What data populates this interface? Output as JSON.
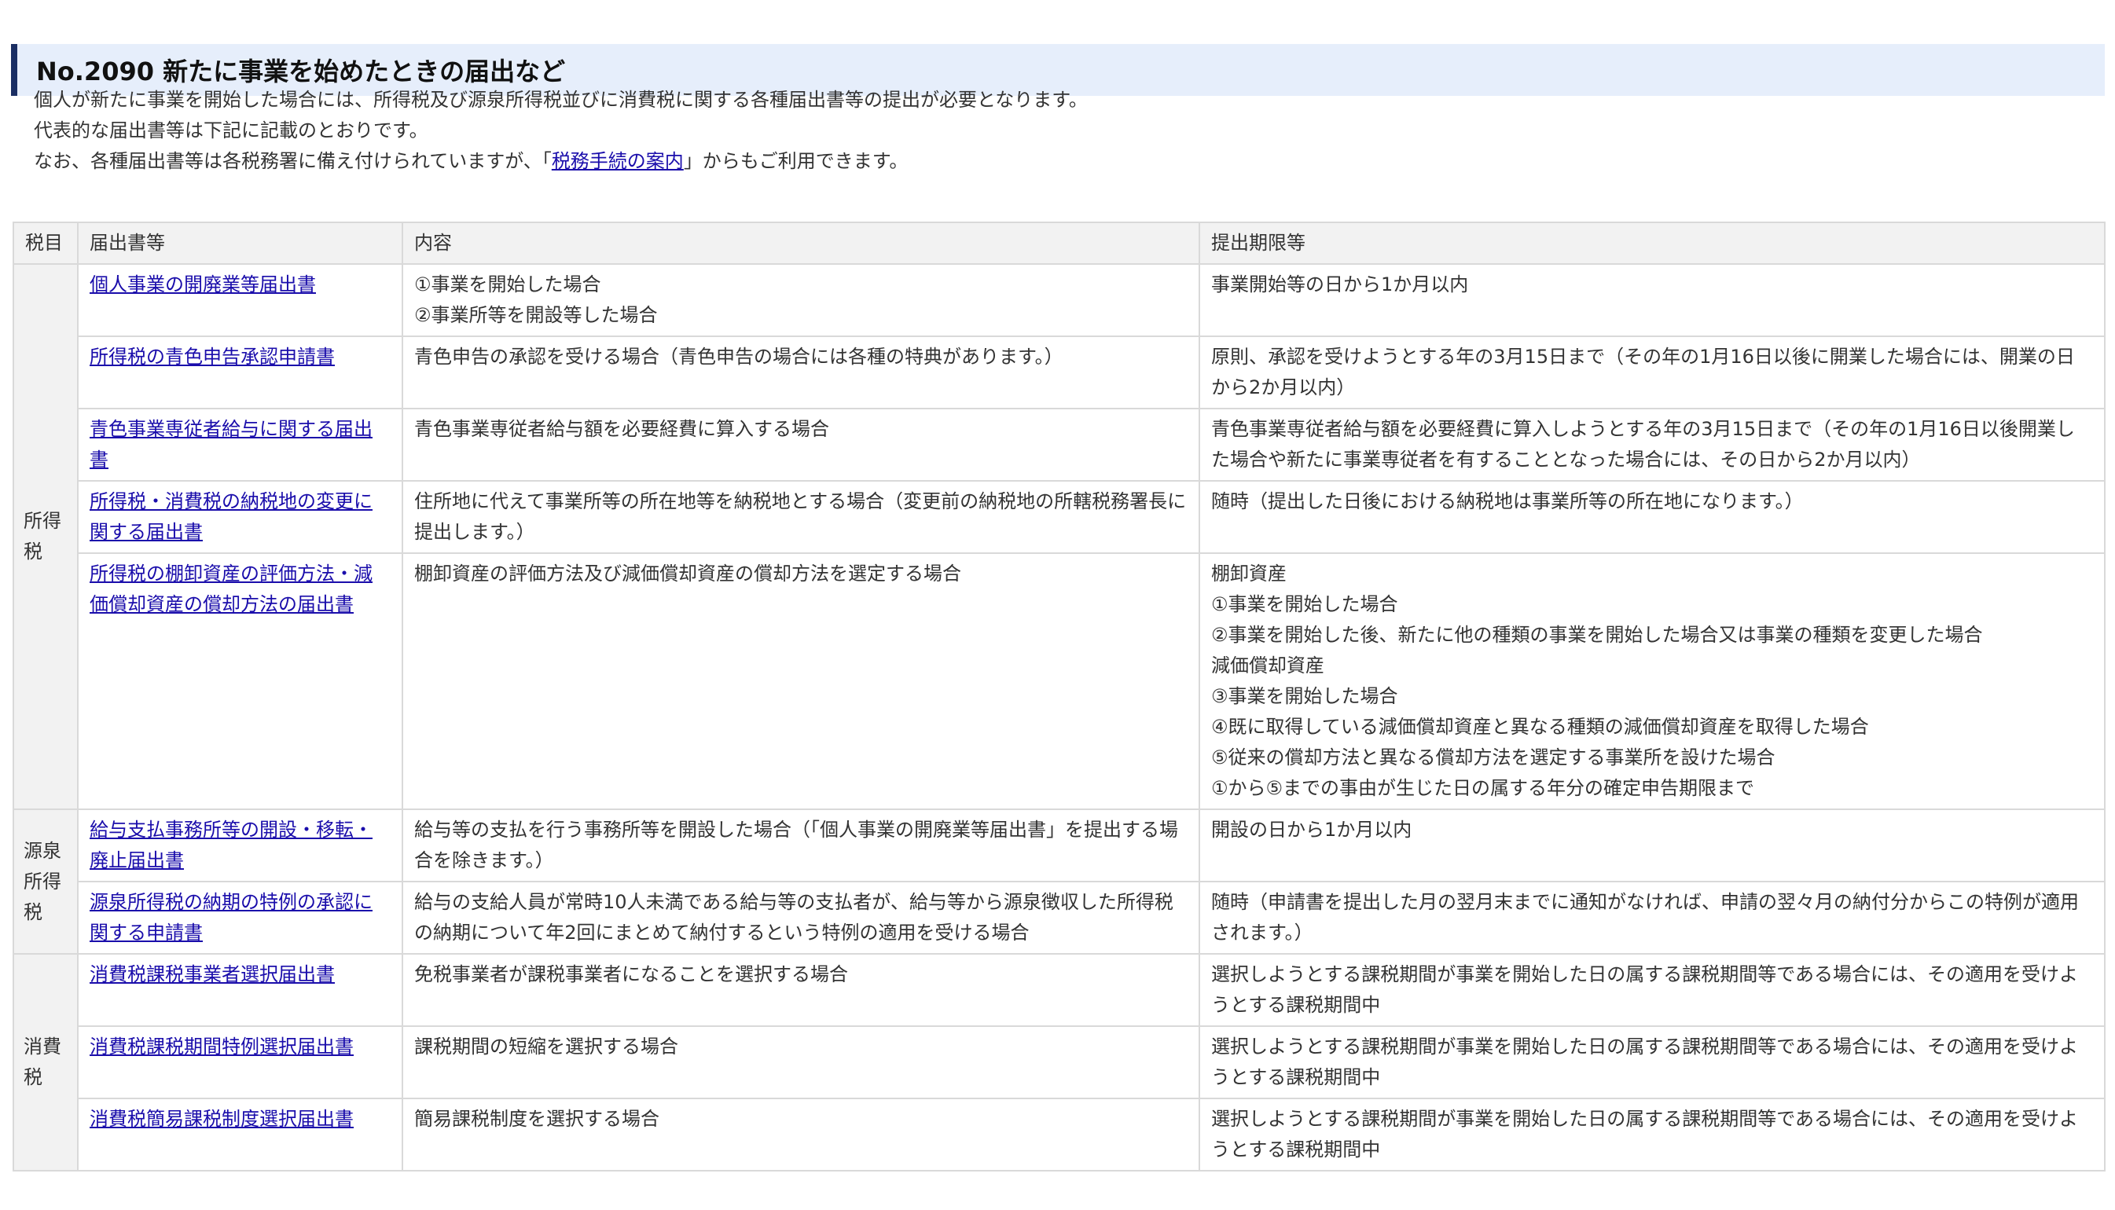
{
  "title": "No.2090 新たに事業を始めたときの届出など",
  "intro": {
    "line1": "個人が新たに事業を開始した場合には、所得税及び源泉所得税並びに消費税に関する各種届出書等の提出が必要となります。",
    "line2": "代表的な届出書等は下記に記載のとおりです。",
    "line3_before": "なお、各種届出書等は各税務署に備え付けられていますが、「",
    "line3_link": "税務手続の案内",
    "line3_after": "」からもご利用できます。"
  },
  "table": {
    "headers": [
      "税目",
      "届出書等",
      "内容",
      "提出期限等"
    ],
    "groups": [
      {
        "tax": "所得税",
        "tax_lines": [
          "所得",
          "税"
        ],
        "rows": [
          {
            "form": "個人事業の開廃業等届出書",
            "content": [
              "①事業を開始した場合",
              "②事業所等を開設等した場合"
            ],
            "deadline": [
              "事業開始等の日から1か月以内"
            ]
          },
          {
            "form": "所得税の青色申告承認申請書",
            "content": [
              "青色申告の承認を受ける場合（青色申告の場合には各種の特典があります。）"
            ],
            "deadline": [
              "原則、承認を受けようとする年の3月15日まで（その年の1月16日以後に開業した場合には、開業の日から2か月以内）"
            ]
          },
          {
            "form": "青色事業専従者給与に関する届出書",
            "content": [
              "青色事業専従者給与額を必要経費に算入する場合"
            ],
            "deadline": [
              "青色事業専従者給与額を必要経費に算入しようとする年の3月15日まで（その年の1月16日以後開業した場合や新たに事業専従者を有することとなった場合には、その日から2か月以内）"
            ]
          },
          {
            "form": "所得税・消費税の納税地の変更に関する届出書",
            "content": [
              "住所地に代えて事業所等の所在地等を納税地とする場合（変更前の納税地の所轄税務署長に提出します。）"
            ],
            "deadline": [
              "随時（提出した日後における納税地は事業所等の所在地になります。）"
            ]
          },
          {
            "form": "所得税の棚卸資産の評価方法・減価償却資産の償却方法の届出書",
            "content": [
              "棚卸資産の評価方法及び減価償却資産の償却方法を選定する場合"
            ],
            "deadline": [
              "棚卸資産",
              "①事業を開始した場合",
              "②事業を開始した後、新たに他の種類の事業を開始した場合又は事業の種類を変更した場合",
              "減価償却資産",
              "③事業を開始した場合",
              "④既に取得している減価償却資産と異なる種類の減価償却資産を取得した場合",
              "⑤従来の償却方法と異なる償却方法を選定する事業所を設けた場合",
              "①から⑤までの事由が生じた日の属する年分の確定申告期限まで"
            ]
          }
        ]
      },
      {
        "tax": "源泉所得税",
        "tax_lines": [
          "源泉",
          "所得",
          "税"
        ],
        "rows": [
          {
            "form": "給与支払事務所等の開設・移転・廃止届出書",
            "content": [
              "給与等の支払を行う事務所等を開設した場合（「個人事業の開廃業等届出書」を提出する場合を除きます。）"
            ],
            "deadline": [
              "開設の日から1か月以内"
            ]
          },
          {
            "form": "源泉所得税の納期の特例の承認に関する申請書",
            "content": [
              "給与の支給人員が常時10人未満である給与等の支払者が、給与等から源泉徴収した所得税の納期について年2回にまとめて納付するという特例の適用を受ける場合"
            ],
            "deadline": [
              "随時（申請書を提出した月の翌月末までに通知がなければ、申請の翌々月の納付分からこの特例が適用されます。）"
            ]
          }
        ]
      },
      {
        "tax": "消費税",
        "tax_lines": [
          "消費",
          "税"
        ],
        "rows": [
          {
            "form": "消費税課税事業者選択届出書",
            "content": [
              "免税事業者が課税事業者になることを選択する場合"
            ],
            "deadline": [
              "選択しようとする課税期間が事業を開始した日の属する課税期間等である場合には、その適用を受けようとする課税期間中"
            ]
          },
          {
            "form": "消費税課税期間特例選択届出書",
            "content": [
              "課税期間の短縮を選択する場合"
            ],
            "deadline": [
              "選択しようとする課税期間が事業を開始した日の属する課税期間等である場合には、その適用を受けようとする課税期間中"
            ]
          },
          {
            "form": "消費税簡易課税制度選択届出書",
            "content": [
              "簡易課税制度を選択する場合"
            ],
            "deadline": [
              "選択しようとする課税期間が事業を開始した日の属する課税期間等である場合には、その適用を受けようとする課税期間中"
            ]
          }
        ]
      }
    ]
  }
}
